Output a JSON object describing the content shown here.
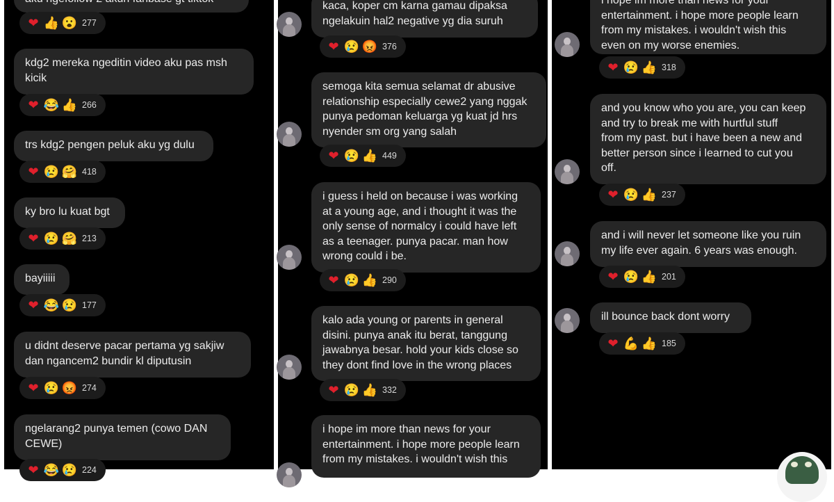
{
  "colors": {
    "panel_bg": "#000000",
    "bubble_bg": "#262626",
    "text": "#ececec",
    "divider": "#ffffff"
  },
  "columns": [
    {
      "comments": [
        {
          "text": "aku ngefollow 2 akun fanbase gt tiktok",
          "reactions": [
            "heart-icon",
            "thumbs-up-icon",
            "surprised-face-icon"
          ],
          "count": "277"
        },
        {
          "text": "kdg2 mereka ngeditin video aku pas msh\nkicik",
          "reactions": [
            "heart-icon",
            "laughing-face-icon",
            "thumbs-up-icon"
          ],
          "count": "266"
        },
        {
          "text": "trs kdg2 pengen peluk aku yg dulu",
          "reactions": [
            "heart-icon",
            "crying-face-icon",
            "hugging-face-icon"
          ],
          "count": "418"
        },
        {
          "text": "ky bro lu kuat bgt",
          "reactions": [
            "heart-icon",
            "crying-face-icon",
            "hugging-face-icon"
          ],
          "count": "213"
        },
        {
          "text": "bayiiiii",
          "reactions": [
            "heart-icon",
            "laughing-face-icon",
            "crying-face-icon"
          ],
          "count": "177"
        },
        {
          "text": "u didnt deserve pacar pertama yg sakjiw\ndan ngancem2 bundir kl diputusin",
          "reactions": [
            "heart-icon",
            "crying-face-icon",
            "angry-face-icon"
          ],
          "count": "274"
        },
        {
          "text": "ngelarang2 punya temen (cowo DAN\nCEWE)",
          "reactions": [
            "heart-icon",
            "laughing-face-icon",
            "crying-face-icon"
          ],
          "count": "224"
        }
      ]
    },
    {
      "comments": [
        {
          "text": "kaca, koper cm karna gamau dipaksa\nngelakuin hal2 negative yg dia suruh",
          "reactions": [
            "heart-icon",
            "crying-face-icon",
            "angry-face-icon"
          ],
          "count": "376"
        },
        {
          "text": "semoga kita semua selamat dr abusive\nrelationship especially cewe2 yang nggak\npunya pedoman keluarga yg kuat jd hrs\nnyender sm org yang salah",
          "reactions": [
            "heart-icon",
            "crying-face-icon",
            "thumbs-up-icon"
          ],
          "count": "449"
        },
        {
          "text": "i guess i held on because i was working\nat a young age, and i thought it was the\nonly sense of normalcy i could have left\nas a teenager. punya pacar. man how\nwrong could i be.",
          "reactions": [
            "heart-icon",
            "crying-face-icon",
            "thumbs-up-icon"
          ],
          "count": "290"
        },
        {
          "text": "kalo ada young or parents in general\ndisini. punya anak itu berat, tanggung\njawabnya besar. hold your kids close so\nthey dont find love in the wrong places",
          "reactions": [
            "heart-icon",
            "crying-face-icon",
            "thumbs-up-icon"
          ],
          "count": "332"
        },
        {
          "text": "i hope im more than news for your\nentertainment. i hope more people learn\nfrom my mistakes. i wouldn't wish this",
          "reactions": [],
          "count": ""
        }
      ]
    },
    {
      "comments": [
        {
          "text": "i hope im more than news for your\nentertainment. i hope more people learn\nfrom my mistakes. i wouldn't wish this\neven on my worse enemies.",
          "reactions": [
            "heart-icon",
            "crying-face-icon",
            "thumbs-up-icon"
          ],
          "count": "318"
        },
        {
          "text": "and you know who you are, you can keep\nand try to break me with hurtful stuff\nfrom my past. but i have been a new and\nbetter person since i learned to cut you\noff.",
          "reactions": [
            "heart-icon",
            "crying-face-icon",
            "thumbs-up-icon"
          ],
          "count": "237"
        },
        {
          "text": "and i will never let someone like you ruin\nmy life ever again. 6 years was enough.",
          "reactions": [
            "heart-icon",
            "crying-face-icon",
            "thumbs-up-icon"
          ],
          "count": "201"
        },
        {
          "text": "ill bounce back dont worry",
          "reactions": [
            "heart-icon",
            "flexed-biceps-icon",
            "thumbs-up-icon"
          ],
          "count": "185"
        }
      ]
    }
  ]
}
